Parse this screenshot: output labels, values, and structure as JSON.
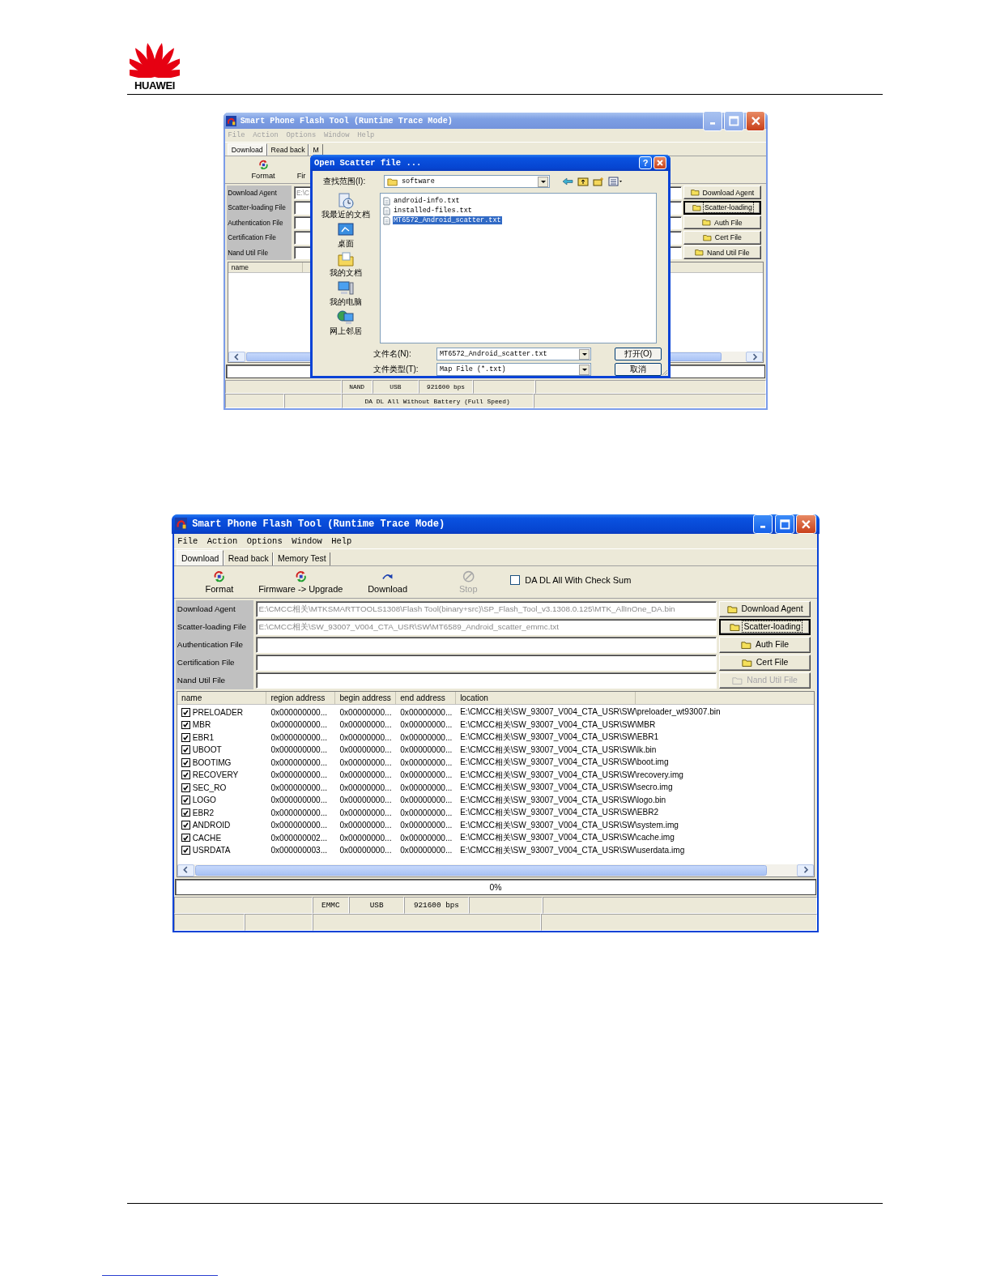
{
  "header": {
    "logo_text": "HUAWEI"
  },
  "screenshots": [
    {
      "title": "Smart Phone Flash Tool (Runtime Trace Mode)",
      "active": false,
      "menu": [
        "File",
        "Action",
        "Options",
        "Window",
        "Help"
      ],
      "tabs": [
        {
          "label": "Download",
          "selected": true
        },
        {
          "label": "Read back",
          "selected": false
        },
        {
          "label": "M",
          "selected": false
        }
      ],
      "toolbar": [
        {
          "kind": "format",
          "label": "Format",
          "disabled": false
        },
        {
          "kind": "text",
          "label": "Fir",
          "disabled": false
        }
      ],
      "file_rows": [
        {
          "label": "Download Agent",
          "value": "E:\\C"
        },
        {
          "label": "Scatter-loading File"
        },
        {
          "label": "Authentication File"
        },
        {
          "label": "Certification File"
        },
        {
          "label": "Nand Util File"
        }
      ],
      "file_buttons": [
        {
          "label": "Download Agent",
          "focused": false,
          "disabled": false
        },
        {
          "label": "Scatter-loading",
          "focused": true,
          "disabled": false
        },
        {
          "label": "Auth File",
          "focused": false,
          "disabled": false
        },
        {
          "label": "Cert File",
          "focused": false,
          "disabled": false
        },
        {
          "label": "Nand Util File",
          "focused": false,
          "disabled": false
        }
      ],
      "table": {
        "columns": [
          "name"
        ]
      },
      "progress": {
        "level": 0
      },
      "status_bar": {
        "connection": [
          "NAND",
          "USB",
          "921600 bps"
        ],
        "message": "DA DL All Without Battery (Full Speed)"
      },
      "dialog": {
        "title": "Open Scatter file ...",
        "help": "?",
        "look_in_label": "查找范围(I):",
        "look_in_value": "software",
        "places": [
          {
            "kind": "recent",
            "label": "我最近的文档"
          },
          {
            "kind": "desktop",
            "label": "桌面"
          },
          {
            "kind": "documents",
            "label": "我的文档"
          },
          {
            "kind": "computer",
            "label": "我的电脑"
          },
          {
            "kind": "network",
            "label": "网上邻居"
          }
        ],
        "files": [
          {
            "name": "android-info.txt",
            "selected": false
          },
          {
            "name": "installed-files.txt",
            "selected": false
          },
          {
            "name": "MT6572_Android_scatter.txt",
            "selected": true
          }
        ],
        "file_name_label": "文件名(N):",
        "file_name_value": "MT6572_Android_scatter.txt",
        "file_type_label": "文件类型(T):",
        "file_type_value": "Map File (*.txt)",
        "open_button": "打开(O)",
        "cancel_button": "取消"
      }
    },
    {
      "title": "Smart Phone Flash Tool (Runtime Trace Mode)",
      "active": true,
      "menu": [
        "File",
        "Action",
        "Options",
        "Window",
        "Help"
      ],
      "tabs": [
        {
          "label": "Download",
          "selected": true
        },
        {
          "label": "Read back",
          "selected": false
        },
        {
          "label": "Memory Test",
          "selected": false
        }
      ],
      "toolbar": [
        {
          "kind": "format",
          "label": "Format",
          "disabled": false
        },
        {
          "kind": "firmware",
          "label": "Firmware -> Upgrade",
          "disabled": false
        },
        {
          "kind": "download",
          "label": "Download",
          "disabled": false
        },
        {
          "kind": "stop",
          "label": "Stop",
          "disabled": true
        }
      ],
      "checkbox": {
        "label": "DA DL All With Check Sum",
        "checked": false
      },
      "file_rows": [
        {
          "label": "Download Agent",
          "value": "E:\\CMCC相关\\MTKSMARTTOOLS1308\\Flash Tool(binary+src)\\SP_Flash_Tool_v3.1308.0.125\\MTK_AllInOne_DA.bin"
        },
        {
          "label": "Scatter-loading File",
          "value": "E:\\CMCC相关\\SW_93007_V004_CTA_USR\\SW\\MT6589_Android_scatter_emmc.txt"
        },
        {
          "label": "Authentication File"
        },
        {
          "label": "Certification File"
        },
        {
          "label": "Nand Util File"
        }
      ],
      "file_buttons": [
        {
          "label": "Download Agent",
          "focused": false,
          "disabled": false
        },
        {
          "label": "Scatter-loading",
          "focused": true,
          "disabled": false
        },
        {
          "label": "Auth File",
          "focused": false,
          "disabled": false
        },
        {
          "label": "Cert File",
          "focused": false,
          "disabled": false
        },
        {
          "label": "Nand Util File",
          "focused": false,
          "disabled": true
        }
      ],
      "table": {
        "columns": [
          "name",
          "region address",
          "begin address",
          "end address",
          "location"
        ],
        "rows": [
          {
            "checked": true,
            "cells": [
              "PRELOADER",
              "0x000000000...",
              "0x00000000...",
              "0x00000000...",
              "E:\\CMCC相关\\SW_93007_V004_CTA_USR\\SW\\preloader_wt93007.bin"
            ]
          },
          {
            "checked": true,
            "cells": [
              "MBR",
              "0x000000000...",
              "0x00000000...",
              "0x00000000...",
              "E:\\CMCC相关\\SW_93007_V004_CTA_USR\\SW\\MBR"
            ]
          },
          {
            "checked": true,
            "cells": [
              "EBR1",
              "0x000000000...",
              "0x00000000...",
              "0x00000000...",
              "E:\\CMCC相关\\SW_93007_V004_CTA_USR\\SW\\EBR1"
            ]
          },
          {
            "checked": true,
            "cells": [
              "UBOOT",
              "0x000000000...",
              "0x00000000...",
              "0x00000000...",
              "E:\\CMCC相关\\SW_93007_V004_CTA_USR\\SW\\lk.bin"
            ]
          },
          {
            "checked": true,
            "cells": [
              "BOOTIMG",
              "0x000000000...",
              "0x00000000...",
              "0x00000000...",
              "E:\\CMCC相关\\SW_93007_V004_CTA_USR\\SW\\boot.img"
            ]
          },
          {
            "checked": true,
            "cells": [
              "RECOVERY",
              "0x000000000...",
              "0x00000000...",
              "0x00000000...",
              "E:\\CMCC相关\\SW_93007_V004_CTA_USR\\SW\\recovery.img"
            ]
          },
          {
            "checked": true,
            "cells": [
              "SEC_RO",
              "0x000000000...",
              "0x00000000...",
              "0x00000000...",
              "E:\\CMCC相关\\SW_93007_V004_CTA_USR\\SW\\secro.img"
            ]
          },
          {
            "checked": true,
            "cells": [
              "LOGO",
              "0x000000000...",
              "0x00000000...",
              "0x00000000...",
              "E:\\CMCC相关\\SW_93007_V004_CTA_USR\\SW\\logo.bin"
            ]
          },
          {
            "checked": true,
            "cells": [
              "EBR2",
              "0x000000000...",
              "0x00000000...",
              "0x00000000...",
              "E:\\CMCC相关\\SW_93007_V004_CTA_USR\\SW\\EBR2"
            ]
          },
          {
            "checked": true,
            "cells": [
              "ANDROID",
              "0x000000000...",
              "0x00000000...",
              "0x00000000...",
              "E:\\CMCC相关\\SW_93007_V004_CTA_USR\\SW\\system.img"
            ]
          },
          {
            "checked": true,
            "cells": [
              "CACHE",
              "0x000000002...",
              "0x00000000...",
              "0x00000000...",
              "E:\\CMCC相关\\SW_93007_V004_CTA_USR\\SW\\cache.img"
            ]
          },
          {
            "checked": true,
            "cells": [
              "USRDATA",
              "0x000000003...",
              "0x00000000...",
              "0x00000000...",
              "E:\\CMCC相关\\SW_93007_V004_CTA_USR\\SW\\userdata.img"
            ]
          }
        ]
      },
      "progress": {
        "text": "0%",
        "level": 0
      },
      "status_bar": {
        "connection": [
          "EMMC",
          "USB",
          "921600 bps"
        ]
      }
    }
  ]
}
